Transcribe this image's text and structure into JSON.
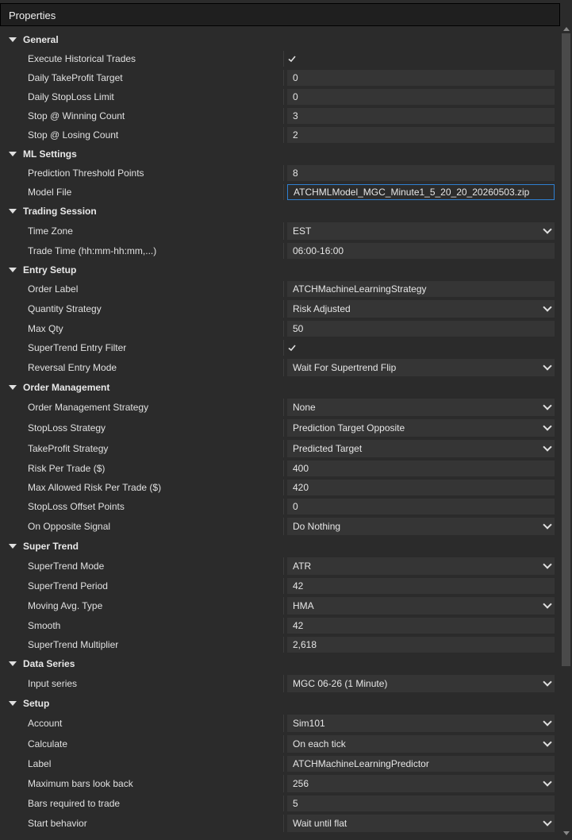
{
  "window": {
    "title": "Properties"
  },
  "sections": [
    {
      "title": "General",
      "rows": [
        {
          "label": "Execute Historical Trades",
          "type": "check",
          "value": ""
        },
        {
          "label": "Daily TakeProfit Target",
          "type": "text",
          "value": "0"
        },
        {
          "label": "Daily StopLoss Limit",
          "type": "text",
          "value": "0"
        },
        {
          "label": "Stop @ Winning Count",
          "type": "text",
          "value": "3"
        },
        {
          "label": "Stop @ Losing Count",
          "type": "text",
          "value": "2"
        }
      ]
    },
    {
      "title": "ML Settings",
      "rows": [
        {
          "label": "Prediction Threshold Points",
          "type": "text",
          "value": "8"
        },
        {
          "label": "Model File",
          "type": "file",
          "value": "ATCHMLModel_MGC_Minute1_5_20_20_20260503.zip"
        }
      ]
    },
    {
      "title": "Trading Session",
      "rows": [
        {
          "label": "Time Zone",
          "type": "select",
          "value": "EST"
        },
        {
          "label": "Trade Time (hh:mm-hh:mm,...)",
          "type": "text",
          "value": "06:00-16:00"
        }
      ]
    },
    {
      "title": "Entry Setup",
      "rows": [
        {
          "label": "Order Label",
          "type": "text",
          "value": "ATCHMachineLearningStrategy"
        },
        {
          "label": "Quantity Strategy",
          "type": "select",
          "value": "Risk Adjusted"
        },
        {
          "label": "Max Qty",
          "type": "text",
          "value": "50"
        },
        {
          "label": "SuperTrend Entry Filter",
          "type": "check",
          "value": ""
        },
        {
          "label": "Reversal Entry Mode",
          "type": "select",
          "value": "Wait For Supertrend Flip"
        }
      ]
    },
    {
      "title": "Order Management",
      "rows": [
        {
          "label": "Order Management Strategy",
          "type": "select",
          "value": "None"
        },
        {
          "label": "StopLoss Strategy",
          "type": "select",
          "value": "Prediction Target Opposite"
        },
        {
          "label": "TakeProfit Strategy",
          "type": "select",
          "value": "Predicted Target"
        },
        {
          "label": "Risk Per Trade ($)",
          "type": "text",
          "value": "400"
        },
        {
          "label": "Max Allowed Risk Per Trade ($)",
          "type": "text",
          "value": "420"
        },
        {
          "label": "StopLoss Offset Points",
          "type": "text",
          "value": "0"
        },
        {
          "label": "On Opposite Signal",
          "type": "select",
          "value": "Do Nothing"
        }
      ]
    },
    {
      "title": "Super Trend",
      "rows": [
        {
          "label": "SuperTrend Mode",
          "type": "select",
          "value": "ATR"
        },
        {
          "label": "SuperTrend Period",
          "type": "text",
          "value": "42"
        },
        {
          "label": "Moving Avg. Type",
          "type": "select",
          "value": "HMA"
        },
        {
          "label": "Smooth",
          "type": "text",
          "value": "42"
        },
        {
          "label": "SuperTrend Multiplier",
          "type": "text",
          "value": "2,618"
        }
      ]
    },
    {
      "title": "Data Series",
      "rows": [
        {
          "label": "Input series",
          "type": "select",
          "value": "MGC 06-26 (1 Minute)"
        }
      ]
    },
    {
      "title": "Setup",
      "rows": [
        {
          "label": "Account",
          "type": "select",
          "value": "Sim101"
        },
        {
          "label": "Calculate",
          "type": "select",
          "value": "On each tick"
        },
        {
          "label": "Label",
          "type": "text",
          "value": "ATCHMachineLearningPredictor"
        },
        {
          "label": "Maximum bars look back",
          "type": "select",
          "value": "256"
        },
        {
          "label": "Bars required to trade",
          "type": "text",
          "value": "5"
        },
        {
          "label": "Start behavior",
          "type": "select",
          "value": "Wait until flat"
        }
      ]
    }
  ]
}
